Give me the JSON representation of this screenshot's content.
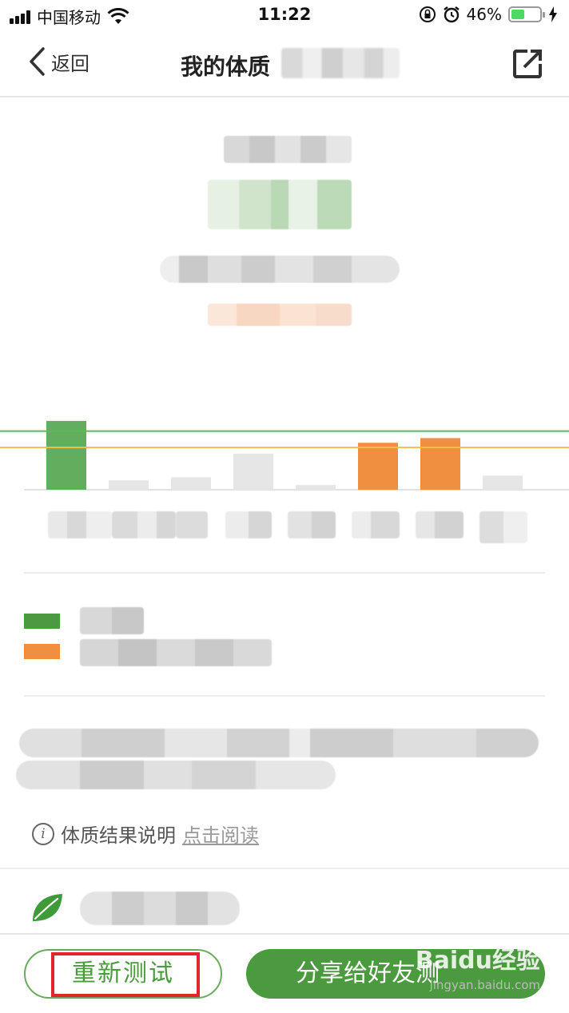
{
  "status_bar": {
    "carrier": "中国移动",
    "time": "11:22",
    "battery": "46%",
    "battery_level": 0.46,
    "icons": [
      "signal-icon",
      "wifi-icon",
      "rotation-lock-icon",
      "alarm-icon",
      "battery-icon",
      "charging-icon"
    ]
  },
  "nav": {
    "back_label": "返回",
    "title": "我的体质",
    "icons": [
      "chevron-left-icon",
      "share-out-icon"
    ]
  },
  "chart_data": {
    "type": "bar",
    "categories": [
      "",
      "",
      "",
      "",
      "",
      "",
      "",
      ""
    ],
    "values": [
      88,
      12,
      16,
      46,
      6,
      60,
      66,
      18
    ],
    "bar_colors": [
      "#63ad5e",
      "#e6e6e6",
      "#e6e6e6",
      "#e6e6e6",
      "#e6e6e6",
      "#ef8f3f",
      "#ef8f3f",
      "#e6e6e6"
    ],
    "reference_lines": [
      {
        "value": 75,
        "color": "#5cb85c"
      },
      {
        "value": 54,
        "color": "#f0c04a"
      }
    ],
    "ylim": [
      0,
      95
    ],
    "xlabel": "",
    "ylabel": "",
    "title": ""
  },
  "legend": {
    "colors": [
      "#4b9a42",
      "#ef8f3f"
    ]
  },
  "explain": {
    "label": "体质结果说明",
    "link": "点击阅读"
  },
  "bottom": {
    "retest_label": "重新测试",
    "share_label": "分享给好友测",
    "watermark": "Baidu经验",
    "watermark_sub": "jingyan.baidu.com"
  }
}
